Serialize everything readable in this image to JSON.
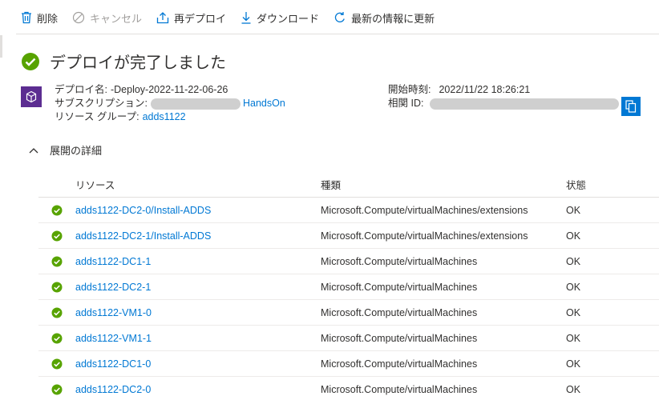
{
  "toolbar": {
    "delete_label": "削除",
    "cancel_label": "キャンセル",
    "redeploy_label": "再デプロイ",
    "download_label": "ダウンロード",
    "refresh_label": "最新の情報に更新"
  },
  "title": "デプロイが完了しました",
  "info": {
    "deploy_name_label": "デプロイ名:",
    "deploy_name_value": "-Deploy-2022-11-22-06-26",
    "subscription_label": "サブスクリプション:",
    "subscription_link": "HandsOn",
    "resource_group_label": "リソース グループ:",
    "resource_group_value": "adds1122",
    "start_time_label": "開始時刻:",
    "start_time_value": "2022/11/22 18:26:21",
    "correlation_id_label": "相関 ID:"
  },
  "section": {
    "title": "展開の詳細"
  },
  "table": {
    "headers": {
      "resource": "リソース",
      "type": "種類",
      "status": "状態"
    },
    "rows": [
      {
        "resource": "adds1122-DC2-0/Install-ADDS",
        "type": "Microsoft.Compute/virtualMachines/extensions",
        "status": "OK"
      },
      {
        "resource": "adds1122-DC2-1/Install-ADDS",
        "type": "Microsoft.Compute/virtualMachines/extensions",
        "status": "OK"
      },
      {
        "resource": "adds1122-DC1-1",
        "type": "Microsoft.Compute/virtualMachines",
        "status": "OK"
      },
      {
        "resource": "adds1122-DC2-1",
        "type": "Microsoft.Compute/virtualMachines",
        "status": "OK"
      },
      {
        "resource": "adds1122-VM1-0",
        "type": "Microsoft.Compute/virtualMachines",
        "status": "OK"
      },
      {
        "resource": "adds1122-VM1-1",
        "type": "Microsoft.Compute/virtualMachines",
        "status": "OK"
      },
      {
        "resource": "adds1122-DC1-0",
        "type": "Microsoft.Compute/virtualMachines",
        "status": "OK"
      },
      {
        "resource": "adds1122-DC2-0",
        "type": "Microsoft.Compute/virtualMachines",
        "status": "OK"
      }
    ]
  },
  "colors": {
    "accent": "#0078d4",
    "success": "#57a300",
    "deploy_icon": "#5c2d91",
    "redacted": "#cfcfcf"
  },
  "icons": {
    "success": "check-circle-icon",
    "deploy": "deployment-icon",
    "copy": "copy-icon"
  }
}
